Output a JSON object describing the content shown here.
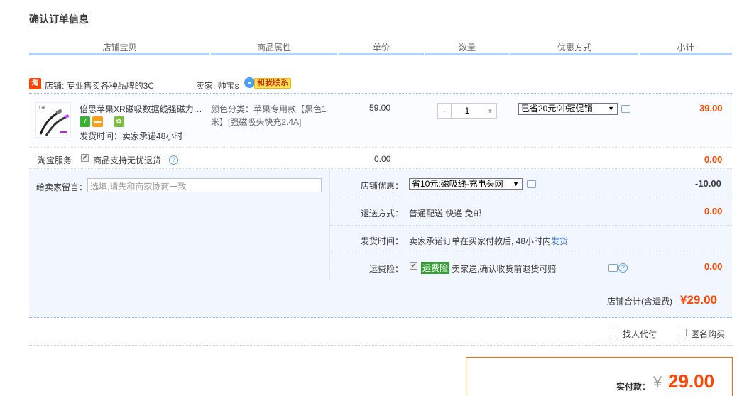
{
  "page_title": "确认订单信息",
  "columns": [
    "店铺宝贝",
    "商品属性",
    "单价",
    "数量",
    "优惠方式",
    "小计"
  ],
  "shop": {
    "logo_text": "淘",
    "shop_label": "店铺: 专业售卖各种品牌的3C",
    "seller_label": "卖家: 帅宝s",
    "contact_button": "和我联系"
  },
  "item": {
    "title": "倍思苹果XR磁吸数据线强磁力充…",
    "ship_time": "发货时间：卖家承诺48小时",
    "sku_text": "颜色分类：苹果专用款【黑色1米】[强磁吸头快充2.4A]",
    "unit_price": "59.00",
    "quantity_minus": "-",
    "quantity": "1",
    "quantity_plus": "+",
    "promo_select": "已省20元:冲冠促销",
    "subtotal": "39.00",
    "badges": [
      {
        "text": "7",
        "color": "#3cb034"
      },
      {
        "text": "▬",
        "color": "#f8a01c"
      },
      {
        "text": "✿",
        "color": "#7cc043"
      }
    ]
  },
  "service": {
    "label": "淘宝服务",
    "checkbox": "✔",
    "text": "商品支持无忧退货",
    "help": "?",
    "price": "0.00",
    "subtotal": "0.00"
  },
  "note": {
    "label": "给卖家留言：",
    "placeholder": "选填,请先和商家协商一致"
  },
  "shop_discount": {
    "label": "店铺优惠：",
    "select": "省10元:磁吸线-充电头网",
    "amount": "-10.00"
  },
  "delivery": {
    "label": "运送方式：",
    "text": "普通配送 快递 免邮",
    "amount": "0.00"
  },
  "ship_time": {
    "label": "发货时间：",
    "text": "卖家承诺订单在买家付款后, 48小时内",
    "link": "发货"
  },
  "insurance": {
    "label": "运费险：",
    "checkbox": "✔",
    "tag": "运费险",
    "text": "卖家送,确认收货前退货可赔",
    "help": "?",
    "amount": "0.00"
  },
  "shop_total": {
    "label": "店铺合计(含运费)",
    "amount": "¥29.00"
  },
  "options": {
    "proxy_pay": "找人代付",
    "anonymous": "匿名购买"
  },
  "payment": {
    "label": "实付款：",
    "currency": "¥",
    "amount": "29.00"
  }
}
